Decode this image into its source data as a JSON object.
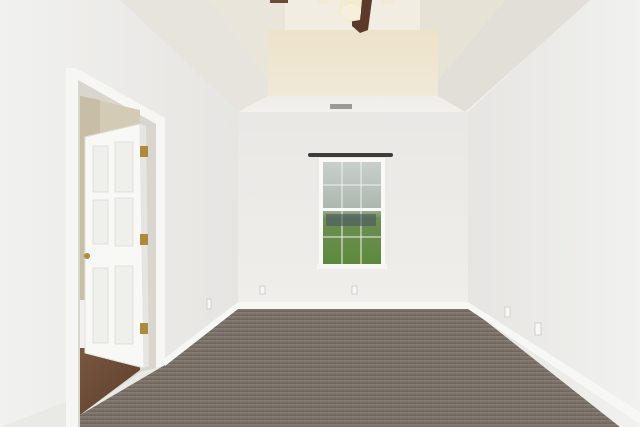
{
  "scene": {
    "subject": "empty bedroom",
    "palette": {
      "wall": "#ecebe8",
      "wall_shadow": "#dedcd8",
      "ceiling": "#eeeae2",
      "carpet": "#7b7169",
      "door": "#f7f7f5",
      "floor_wood": "#6b4a34",
      "window_glass": "#9aa48f",
      "grass": "#5f8a3e"
    }
  }
}
